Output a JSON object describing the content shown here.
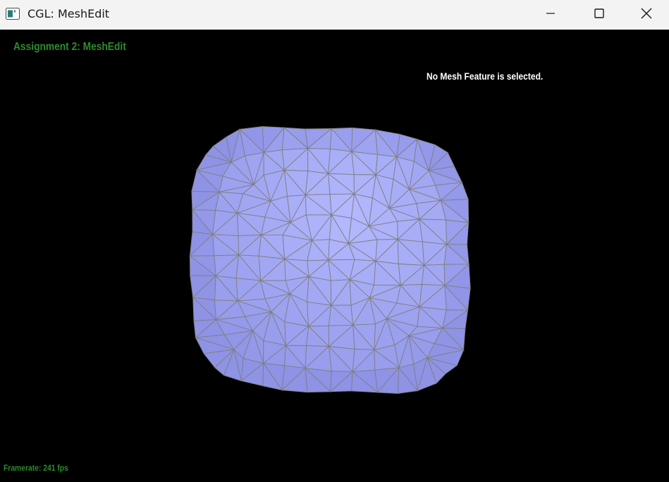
{
  "window": {
    "title": "CGL: MeshEdit",
    "icons": {
      "app": "app-window-icon",
      "minimize": "minimize-icon",
      "maximize": "maximize-icon",
      "close": "close-icon"
    }
  },
  "viewport": {
    "assignment_title": "Assignment 2: MeshEdit",
    "selection_status": "No Mesh Feature is selected.",
    "framerate": "Framerate: 241 fps"
  },
  "colors": {
    "background": "#000000",
    "titlebar": "#f3f3f3",
    "hud_green": "#2e8b2e",
    "hud_white": "#ffffff",
    "mesh_fill": "#9da2ff",
    "mesh_edge": "#7f7f7f"
  }
}
